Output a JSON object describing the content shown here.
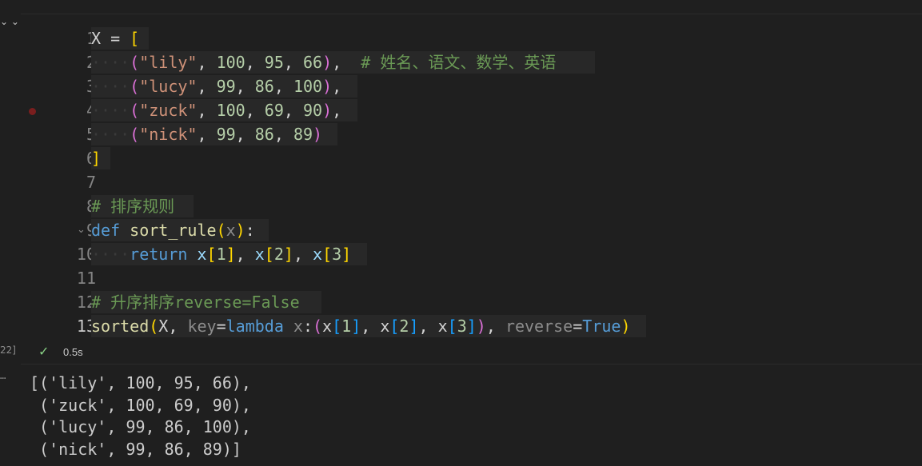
{
  "cell": {
    "execution_count": "22]",
    "status_time": "0.5s"
  },
  "code_lines": [
    {
      "n": "1"
    },
    {
      "n": "2",
      "comment": "# 姓名、语文、数学、英语"
    },
    {
      "n": "3"
    },
    {
      "n": "4"
    },
    {
      "n": "5"
    },
    {
      "n": "6"
    },
    {
      "n": "7"
    },
    {
      "n": "8",
      "comment": "# 排序规则"
    },
    {
      "n": "9"
    },
    {
      "n": "10"
    },
    {
      "n": "11"
    },
    {
      "n": "12",
      "comment": "# 升序排序reverse=False"
    },
    {
      "n": "13"
    }
  ],
  "code": {
    "l1": {
      "var": "X",
      "op": " = ",
      "open": "["
    },
    "l2": {
      "name": "\"lily\"",
      "a": "100",
      "b": "95",
      "c": "66"
    },
    "l3": {
      "name": "\"lucy\"",
      "a": "99",
      "b": "86",
      "c": "100"
    },
    "l4": {
      "name": "\"zuck\"",
      "a": "100",
      "b": "69",
      "c": "90"
    },
    "l5": {
      "name": "\"nick\"",
      "a": "99",
      "b": "86",
      "c": "89"
    },
    "l6": {
      "close": "]"
    },
    "l9": {
      "kw": "def",
      "fn": "sort_rule",
      "param": "x"
    },
    "l10": {
      "kw": "return",
      "i1": "1",
      "i2": "2",
      "i3": "3"
    },
    "l13": {
      "fn": "sorted",
      "arg": "X",
      "key": "key",
      "lambda": "lambda",
      "lx": "x",
      "reverse": "reverse",
      "true": "True"
    }
  },
  "output": {
    "lines": [
      "[('lily', 100, 95, 66),",
      " ('zuck', 100, 69, 90),",
      " ('lucy', 99, 86, 100),",
      " ('nick', 99, 86, 89)]"
    ]
  }
}
